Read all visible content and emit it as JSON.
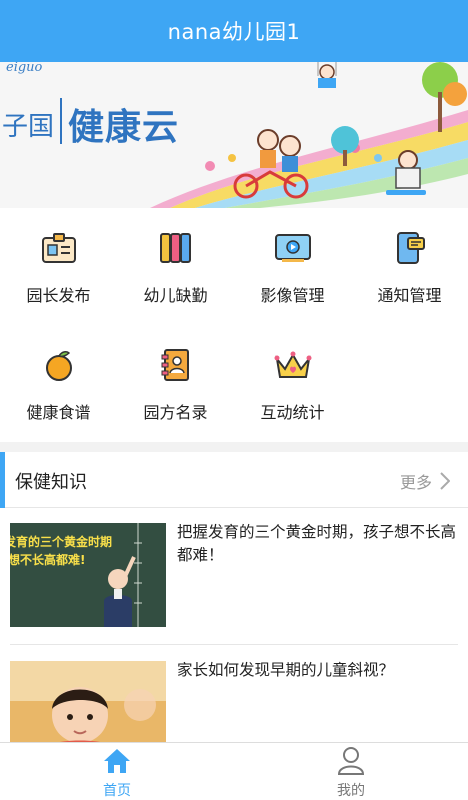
{
  "header": {
    "title": "nana幼儿园1"
  },
  "banner": {
    "brand_left": "eiguo",
    "brand_left2": "子国",
    "brand_main": "健康云"
  },
  "menu": {
    "items": [
      {
        "label": "园长发布",
        "icon": "id-card-icon"
      },
      {
        "label": "幼儿缺勤",
        "icon": "books-icon"
      },
      {
        "label": "影像管理",
        "icon": "video-icon"
      },
      {
        "label": "通知管理",
        "icon": "notification-phone-icon"
      },
      {
        "label": "健康食谱",
        "icon": "orange-icon"
      },
      {
        "label": "园方名录",
        "icon": "address-book-icon"
      },
      {
        "label": "互动统计",
        "icon": "crown-icon"
      }
    ]
  },
  "health": {
    "title": "保健知识",
    "more": "更多",
    "articles": [
      {
        "title": "把握发育的三个黄金时期，孩子想不长高都难！",
        "thumb_text1": "发育的三个黄金时期",
        "thumb_text2": "想不长高都难!"
      },
      {
        "title": "家长如何发现早期的儿童斜视？"
      }
    ]
  },
  "tabbar": {
    "home": "首页",
    "mine": "我的"
  },
  "colors": {
    "accent": "#3ea6f4",
    "header_bg": "#3ea6f4"
  }
}
